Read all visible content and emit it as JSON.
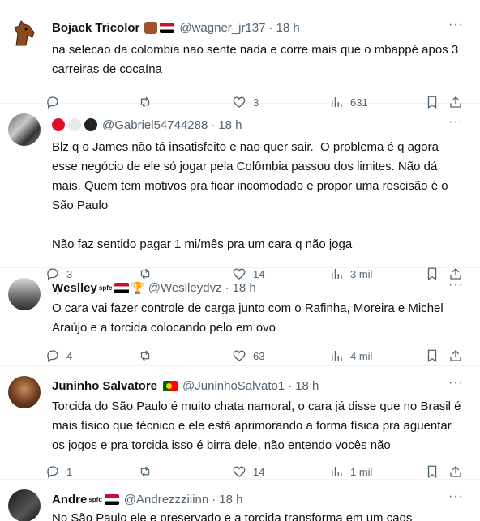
{
  "tweets": [
    {
      "name": "Bojack Tricolor",
      "handle": "@wagner_jr137",
      "time": "18 h",
      "text": "na selecao da colombia nao sente nada e corre mais que o mbappé apos 3 carreiras de cocaína",
      "replies": "",
      "retweets": "",
      "likes": "3",
      "views": "631"
    },
    {
      "name": "",
      "handle": "@Gabriel54744288",
      "time": "18 h",
      "text": "Blz q o James não tá insatisfeito e nao quer sair.  O problema é q agora esse negócio de ele só jogar pela Colômbia passou dos limites. Não dá mais. Quem tem motivos pra ficar incomodado e propor uma rescisão é o São Paulo\n\nNão faz sentido pagar 1 mi/mês pra um cara q não joga",
      "replies": "3",
      "retweets": "",
      "likes": "14",
      "views": "3 mil"
    },
    {
      "name": "Ẉeslley",
      "badge": "spfc",
      "handle": "@Weslleydvz",
      "time": "18 h",
      "text": "O cara vai fazer controle de carga junto com o Rafinha, Moreira e Michel Araújo e a torcida colocando pelo em ovo",
      "replies": "4",
      "retweets": "",
      "likes": "63",
      "views": "4 mil"
    },
    {
      "name": "Juninho Salvatore",
      "handle": "@JuninhoSalvato1",
      "time": "18 h",
      "text": "Torcida do São Paulo é muito chata namoral, o cara já disse que no Brasil é mais físico que técnico e ele está aprimorando a forma física pra aguentar os jogos e pra torcida isso é birra dele, não entendo vocês não",
      "replies": "1",
      "retweets": "",
      "likes": "14",
      "views": "1 mil"
    },
    {
      "name": "Andre",
      "badge": "spfc",
      "handle": "@Andrezzziiinn",
      "time": "18 h",
      "text": "No São Paulo ele e preservado e a torcida transforma em um caos"
    }
  ],
  "ui": {
    "more": "···",
    "dot": "·",
    "trophy": "🏆"
  },
  "colors": {
    "secondary_text": "#536471",
    "divider": "#eff3f4"
  }
}
